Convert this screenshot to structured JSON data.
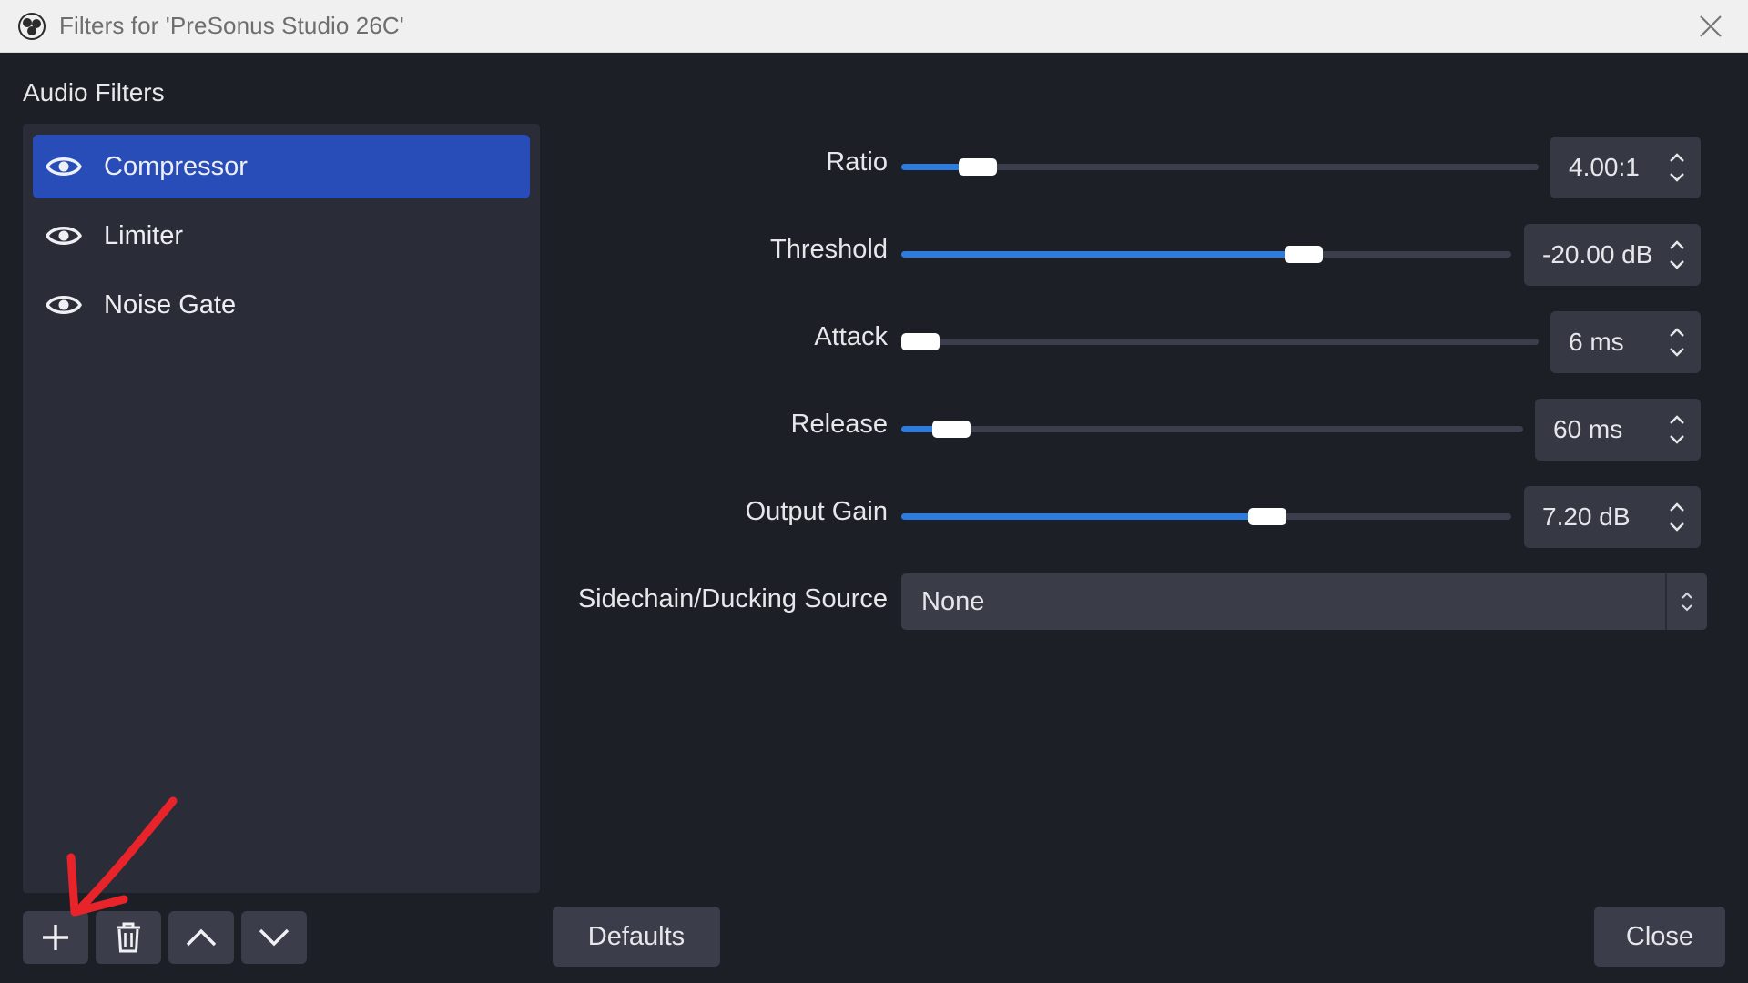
{
  "window": {
    "title": "Filters for 'PreSonus Studio 26C'"
  },
  "audio_filters": {
    "section_label": "Audio Filters",
    "items": [
      {
        "label": "Compressor",
        "visible": true,
        "selected": true
      },
      {
        "label": "Limiter",
        "visible": true,
        "selected": false
      },
      {
        "label": "Noise Gate",
        "visible": true,
        "selected": false
      }
    ]
  },
  "toolbar": {
    "add": "plus-icon",
    "remove": "trash-icon",
    "move_up": "chevron-up-icon",
    "move_down": "chevron-down-icon"
  },
  "properties": {
    "ratio": {
      "label": "Ratio",
      "value": "4.00:1",
      "level": 0.12
    },
    "threshold": {
      "label": "Threshold",
      "value": "-20.00 dB",
      "level": 0.66
    },
    "attack": {
      "label": "Attack",
      "value": "6 ms",
      "level": 0.03
    },
    "release": {
      "label": "Release",
      "value": "60 ms",
      "level": 0.08
    },
    "output_gain": {
      "label": "Output Gain",
      "value": "7.20 dB",
      "level": 0.6
    },
    "sidechain": {
      "label": "Sidechain/Ducking Source",
      "value": "None"
    }
  },
  "buttons": {
    "defaults": "Defaults",
    "close": "Close"
  },
  "colors": {
    "accent": "#2e7be0",
    "selection": "#284cb8",
    "annotation": "#e8232a"
  }
}
